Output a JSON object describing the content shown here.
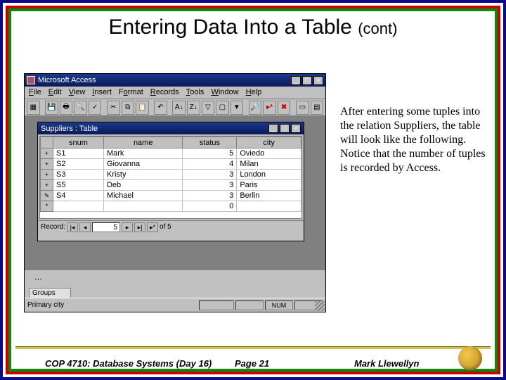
{
  "slide": {
    "title_main": "Entering Data Into a Table",
    "title_sub": "(cont)",
    "body": "After entering some tuples into the relation Suppliers, the table will look like the following. Notice that the number of tuples is recorded by Access.",
    "footer_left": "COP 4710: Database Systems  (Day 16)",
    "footer_center": "Page 21",
    "footer_right": "Mark Llewellyn"
  },
  "access": {
    "app_title": "Microsoft Access",
    "menus": [
      "File",
      "Edit",
      "View",
      "Insert",
      "Format",
      "Records",
      "Tools",
      "Window",
      "Help"
    ],
    "winbtns": {
      "min": "_",
      "max": "□",
      "close": "×"
    },
    "sub_title": "Suppliers : Table",
    "columns": [
      "snum",
      "name",
      "status",
      "city"
    ],
    "rows": [
      {
        "marker": "+",
        "snum": "S1",
        "name": "Mark",
        "status": "5",
        "city": "Oviedo"
      },
      {
        "marker": "+",
        "snum": "S2",
        "name": "Giovanna",
        "status": "4",
        "city": "Milan"
      },
      {
        "marker": "+",
        "snum": "S3",
        "name": "Kristy",
        "status": "3",
        "city": "London"
      },
      {
        "marker": "+",
        "snum": "S5",
        "name": "Deb",
        "status": "3",
        "city": "Paris"
      },
      {
        "marker": "✎",
        "snum": "S4",
        "name": "Michael",
        "status": "3",
        "city": "Berlin"
      },
      {
        "marker": "*",
        "snum": "",
        "name": "",
        "status": "0",
        "city": ""
      }
    ],
    "record_nav": {
      "label": "Record:",
      "pos": "5",
      "total": "of  5",
      "first": "|◂",
      "prev": "◂",
      "next": "▸",
      "last": "▸|",
      "new": "▸*"
    },
    "sidebar": {
      "groups_label": "Groups"
    },
    "status": {
      "left": "Primary city",
      "num": "NUM"
    }
  }
}
